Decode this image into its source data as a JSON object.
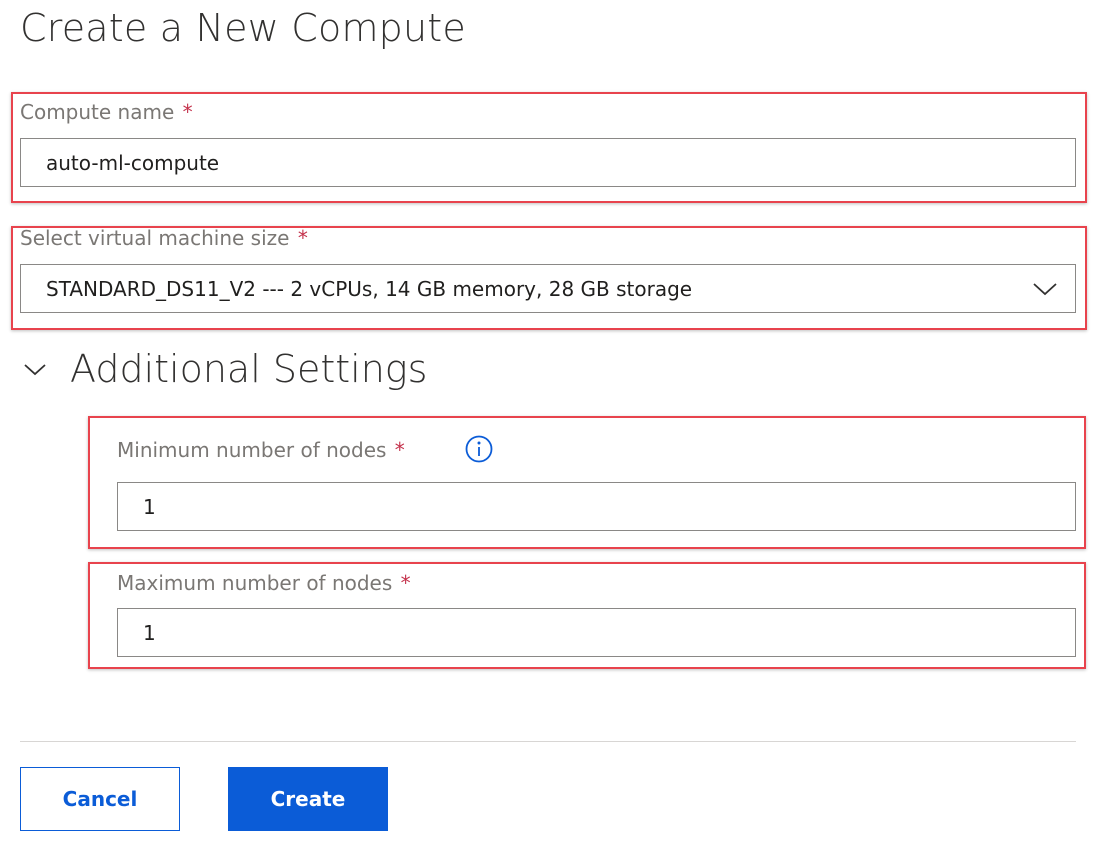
{
  "page": {
    "title": "Create a New Compute"
  },
  "form": {
    "compute_name": {
      "label": "Compute name",
      "required_marker": "*",
      "value": "auto-ml-compute"
    },
    "vm_size": {
      "label": "Select virtual machine size",
      "required_marker": "*",
      "selected_value": "STANDARD_DS11_V2 --- 2 vCPUs, 14 GB memory, 28 GB storage",
      "icon": "chevron-down-icon"
    },
    "additional_settings": {
      "title": "Additional Settings",
      "icon": "chevron-down-icon",
      "expanded": true,
      "min_nodes": {
        "label": "Minimum number of nodes",
        "required_marker": "*",
        "value": "1",
        "info_icon": "info-icon"
      },
      "max_nodes": {
        "label": "Maximum number of nodes",
        "required_marker": "*",
        "value": "1"
      }
    }
  },
  "actions": {
    "cancel_label": "Cancel",
    "create_label": "Create"
  },
  "colors": {
    "accent": "#0b5cd7",
    "highlight_border": "#e8434d",
    "required_marker": "#c4314b",
    "label_text": "#7a7774"
  }
}
